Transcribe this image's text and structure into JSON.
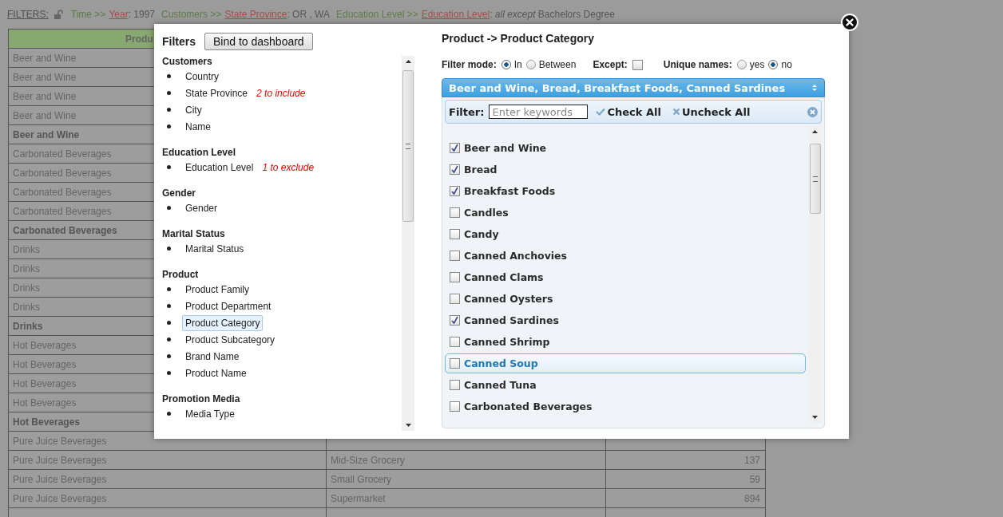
{
  "filters_bar": {
    "label": "FILTERS:",
    "locked": false,
    "filters": [
      {
        "path": "Time >>",
        "level": "Year",
        "value": ": 1997"
      },
      {
        "path": "Customers >>",
        "level": "State Province",
        "value": ": OR , WA"
      },
      {
        "path": "Education Level >>",
        "level": "Education Level",
        "value": ": *all except* Bachelors Degree"
      }
    ]
  },
  "table": {
    "header": [
      "Produ"
    ],
    "rows": [
      {
        "kind": "detail",
        "cells": [
          "Beer and Wine"
        ]
      },
      {
        "kind": "detail",
        "cells": [
          "Beer and Wine"
        ]
      },
      {
        "kind": "detail",
        "cells": [
          "Beer and Wine"
        ]
      },
      {
        "kind": "detail",
        "cells": [
          "Beer and Wine"
        ]
      },
      {
        "kind": "total",
        "cells": [
          "Beer and Wine"
        ]
      },
      {
        "kind": "detail",
        "cells": [
          "Carbonated Beverages"
        ]
      },
      {
        "kind": "detail",
        "cells": [
          "Carbonated Beverages"
        ]
      },
      {
        "kind": "detail",
        "cells": [
          "Carbonated Beverages"
        ]
      },
      {
        "kind": "detail",
        "cells": [
          "Carbonated Beverages"
        ]
      },
      {
        "kind": "total",
        "cells": [
          "Carbonated Beverages"
        ]
      },
      {
        "kind": "detail",
        "cells": [
          "Drinks"
        ]
      },
      {
        "kind": "detail",
        "cells": [
          "Drinks"
        ]
      },
      {
        "kind": "detail",
        "cells": [
          "Drinks"
        ]
      },
      {
        "kind": "detail",
        "cells": [
          "Drinks"
        ]
      },
      {
        "kind": "total",
        "cells": [
          "Drinks"
        ]
      },
      {
        "kind": "detail",
        "cells": [
          "Hot Beverages"
        ]
      },
      {
        "kind": "detail",
        "cells": [
          "Hot Beverages"
        ]
      },
      {
        "kind": "detail",
        "cells": [
          "Hot Beverages"
        ]
      },
      {
        "kind": "detail",
        "cells": [
          "Hot Beverages"
        ]
      },
      {
        "kind": "total",
        "cells": [
          "Hot Beverages"
        ]
      },
      {
        "kind": "detail",
        "cells": [
          "Pure Juice Beverages"
        ]
      },
      {
        "kind": "detail",
        "cells": [
          "Pure Juice Beverages",
          "Mid-Size Grocery",
          "137"
        ]
      },
      {
        "kind": "detail",
        "cells": [
          "Pure Juice Beverages",
          "Small Grocery",
          "59"
        ]
      },
      {
        "kind": "detail",
        "cells": [
          "Pure Juice Beverages",
          "Supermarket",
          "894"
        ]
      },
      {
        "kind": "total",
        "cells": []
      }
    ]
  },
  "modal": {
    "left": {
      "title": "Filters",
      "bind_button": "Bind to dashboard",
      "sections": [
        {
          "heading": "Customers",
          "items": [
            {
              "label": "Country",
              "selected": false
            },
            {
              "label": "State Province",
              "note": "2 to include",
              "selected": false
            },
            {
              "label": "City",
              "selected": false
            },
            {
              "label": "Name",
              "selected": false
            }
          ]
        },
        {
          "heading": "Education Level",
          "items": [
            {
              "label": "Education Level",
              "note": "1 to exclude",
              "selected": false
            }
          ]
        },
        {
          "heading": "Gender",
          "items": [
            {
              "label": "Gender",
              "selected": false
            }
          ]
        },
        {
          "heading": "Marital Status",
          "items": [
            {
              "label": "Marital Status",
              "selected": false
            }
          ]
        },
        {
          "heading": "Product",
          "items": [
            {
              "label": "Product Family",
              "selected": false
            },
            {
              "label": "Product Department",
              "selected": false
            },
            {
              "label": "Product Category",
              "selected": true
            },
            {
              "label": "Product Subcategory",
              "selected": false
            },
            {
              "label": "Brand Name",
              "selected": false
            },
            {
              "label": "Product Name",
              "selected": false
            }
          ]
        },
        {
          "heading": "Promotion Media",
          "items": [
            {
              "label": "Media Type",
              "selected": false
            }
          ]
        }
      ]
    },
    "right": {
      "title": "Product -> Product Category",
      "filter_mode": {
        "label": "Filter mode:",
        "options": [
          {
            "label": "In",
            "selected": true
          },
          {
            "label": "Between",
            "selected": false
          }
        ]
      },
      "except": {
        "label": "Except:",
        "checked": false
      },
      "unique_names": {
        "label": "Unique names:",
        "options": [
          {
            "label": "yes",
            "selected": false
          },
          {
            "label": "no",
            "selected": true
          }
        ]
      },
      "dropdown": {
        "value": "Beer and Wine, Bread, Breakfast Foods, Canned Sardines",
        "expanded": true
      },
      "panel": {
        "filter_label": "Filter:",
        "placeholder": "Enter keywords",
        "check_all": "Check All",
        "uncheck_all": "Uncheck All",
        "items": [
          {
            "label": "Beer and Wine",
            "checked": true,
            "hovered": false
          },
          {
            "label": "Bread",
            "checked": true,
            "hovered": false
          },
          {
            "label": "Breakfast Foods",
            "checked": true,
            "hovered": false
          },
          {
            "label": "Candles",
            "checked": false,
            "hovered": false
          },
          {
            "label": "Candy",
            "checked": false,
            "hovered": false
          },
          {
            "label": "Canned Anchovies",
            "checked": false,
            "hovered": false
          },
          {
            "label": "Canned Clams",
            "checked": false,
            "hovered": false
          },
          {
            "label": "Canned Oysters",
            "checked": false,
            "hovered": false
          },
          {
            "label": "Canned Sardines",
            "checked": true,
            "hovered": false
          },
          {
            "label": "Canned Shrimp",
            "checked": false,
            "hovered": false
          },
          {
            "label": "Canned Soup",
            "checked": false,
            "hovered": true
          },
          {
            "label": "Canned Tuna",
            "checked": false,
            "hovered": false
          },
          {
            "label": "Carbonated Beverages",
            "checked": false,
            "hovered": false
          }
        ]
      }
    }
  }
}
